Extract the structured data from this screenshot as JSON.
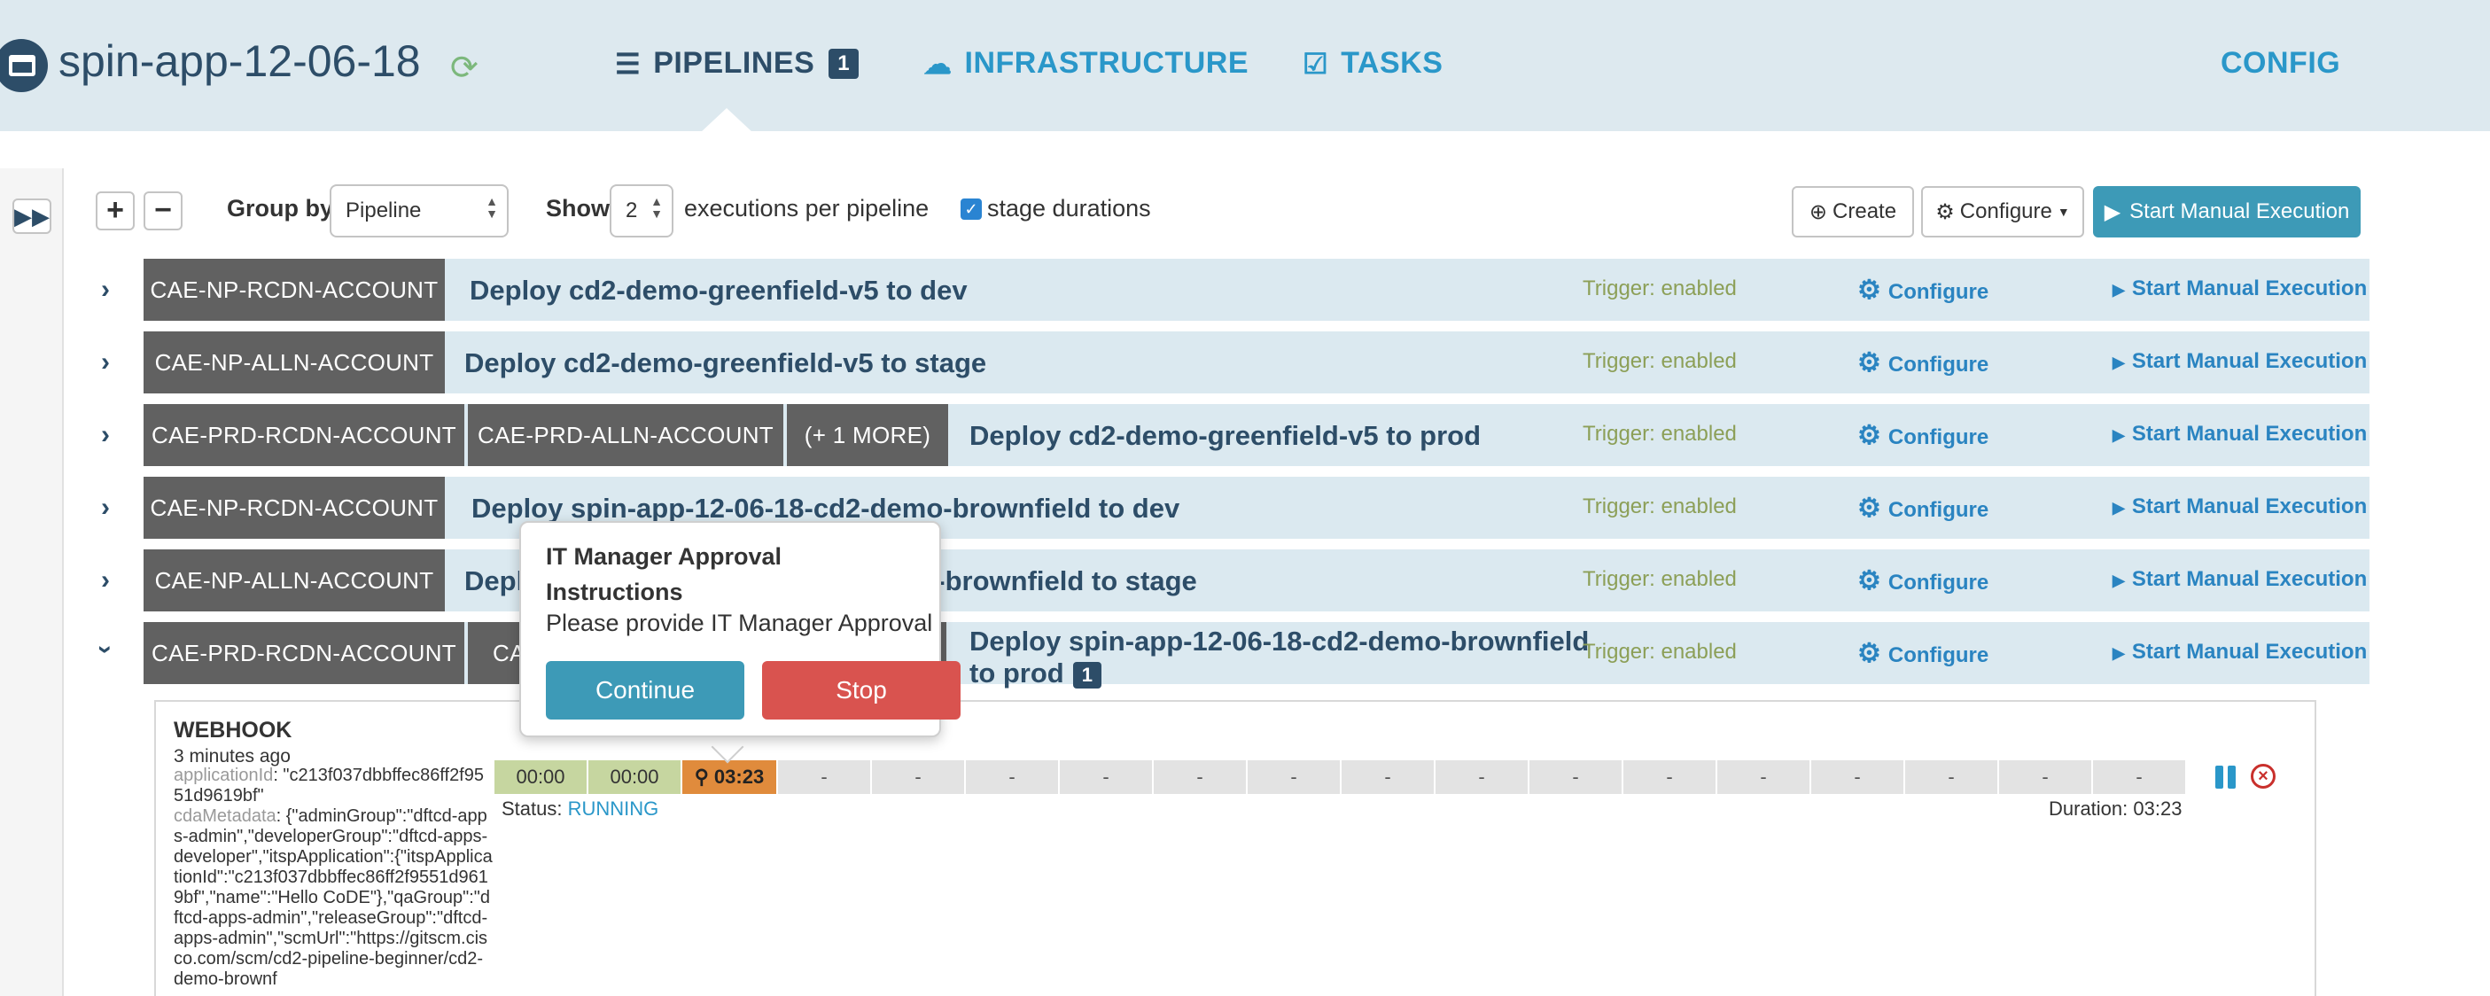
{
  "header": {
    "app_title": "spin-app-12-06-18",
    "nav": {
      "pipelines": "PIPELINES",
      "pipelines_badge": "1",
      "infrastructure": "INFRASTRUCTURE",
      "tasks": "TASKS",
      "config": "CONFIG"
    }
  },
  "toolbar": {
    "group_by_label": "Group by",
    "group_by_value": "Pipeline",
    "show_label": "Show",
    "show_value": "2",
    "executions_label": "executions per pipeline",
    "stage_durations_label": "stage durations",
    "stage_durations_checked": true,
    "create_label": "Create",
    "configure_label": "Configure",
    "start_manual_label": "Start Manual Execution"
  },
  "pipelines": [
    {
      "tags": [
        "CAE-NP-RCDN-ACCOUNT"
      ],
      "name": "Deploy cd2-demo-greenfield-v5 to dev",
      "trigger": "Trigger: enabled",
      "configure": "Configure",
      "start": "Start Manual Execution"
    },
    {
      "tags": [
        "CAE-NP-ALLN-ACCOUNT"
      ],
      "name": "Deploy cd2-demo-greenfield-v5 to stage",
      "trigger": "Trigger: enabled",
      "configure": "Configure",
      "start": "Start Manual Execution"
    },
    {
      "tags": [
        "CAE-PRD-RCDN-ACCOUNT",
        "CAE-PRD-ALLN-ACCOUNT",
        "(+ 1 MORE)"
      ],
      "name": "Deploy cd2-demo-greenfield-v5 to prod",
      "trigger": "Trigger: enabled",
      "configure": "Configure",
      "start": "Start Manual Execution"
    },
    {
      "tags": [
        "CAE-NP-RCDN-ACCOUNT"
      ],
      "name": "Deploy spin-app-12-06-18-cd2-demo-brownfield to dev",
      "trigger": "Trigger: enabled",
      "configure": "Configure",
      "start": "Start Manual Execution"
    },
    {
      "tags": [
        "CAE-NP-ALLN-ACCOUNT"
      ],
      "name": "Deploy spin-app-12-06-18-cd2-demo-brownfield to stage",
      "trigger": "Trigger: enabled",
      "configure": "Configure",
      "start": "Start Manual Execution"
    },
    {
      "tags": [
        "CAE-PRD-RCDN-ACCOUNT",
        "CA"
      ],
      "name": "Deploy spin-app-12-06-18-cd2-demo-brownfield to prod",
      "running_badge": "1",
      "trigger": "Trigger: enabled",
      "configure": "Configure",
      "start": "Start Manual Execution"
    }
  ],
  "execution": {
    "trigger_type": "WEBHOOK",
    "time_ago": "3 minutes ago",
    "application_id_key": "applicationId",
    "application_id_value": ": \"c213f037dbbffec86ff2f9551d9619bf\"",
    "cda_metadata_key": "cdaMetadata",
    "cda_metadata_value": ": {\"adminGroup\":\"dftcd-apps-admin\",\"developerGroup\":\"dftcd-apps-developer\",\"itspApplication\":{\"itspApplicationId\":\"c213f037dbbffec86ff2f9551d9619bf\",\"name\":\"Hello CoDE\"},\"qaGroup\":\"dftcd-apps-admin\",\"releaseGroup\":\"dftcd-apps-admin\",\"scmUrl\":\"https://gitscm.cisco.com/scm/cd2-pipeline-beginner/cd2-demo-brownf",
    "stages": [
      "00:00",
      "00:00",
      "03:23",
      "-",
      "-",
      "-",
      "-",
      "-",
      "-",
      "-",
      "-",
      "-",
      "-",
      "-",
      "-",
      "-",
      "-",
      "-"
    ],
    "status_label": "Status:",
    "status_value": "RUNNING",
    "duration": "Duration: 03:23"
  },
  "popover": {
    "title": "IT Manager Approval Instructions",
    "message": "Please provide IT Manager Approval",
    "continue_label": "Continue",
    "stop_label": "Stop"
  }
}
